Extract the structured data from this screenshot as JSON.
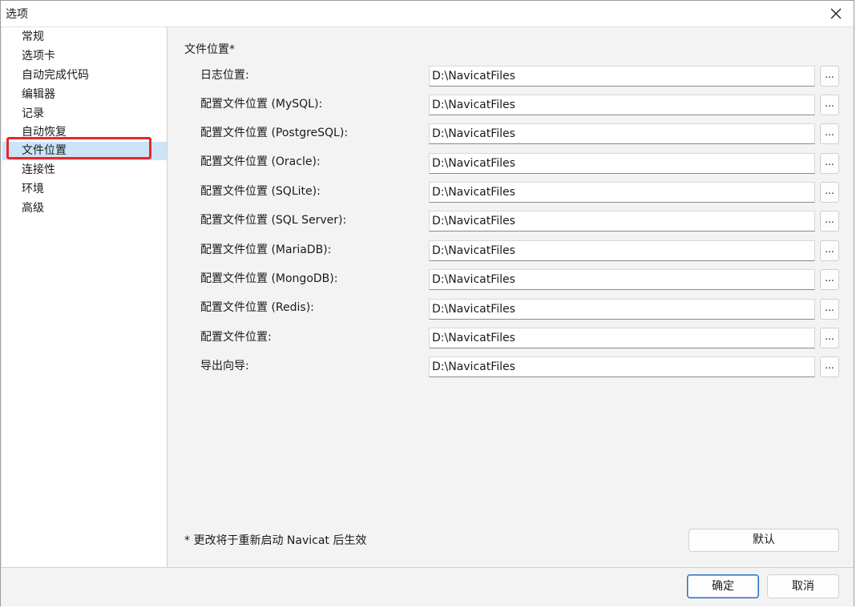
{
  "window": {
    "title": "选项",
    "close_icon": "close-icon"
  },
  "sidebar": {
    "selected_index": 6,
    "items": [
      {
        "label": "常规"
      },
      {
        "label": "选项卡"
      },
      {
        "label": "自动完成代码"
      },
      {
        "label": "编辑器"
      },
      {
        "label": "记录"
      },
      {
        "label": "自动恢复"
      },
      {
        "label": "文件位置"
      },
      {
        "label": "连接性"
      },
      {
        "label": "环境"
      },
      {
        "label": "高级"
      }
    ]
  },
  "main": {
    "section_title": "文件位置*",
    "rows": [
      {
        "label": "日志位置:",
        "value": "D:\\NavicatFiles",
        "button": "..."
      },
      {
        "label": "配置文件位置 (MySQL):",
        "value": "D:\\NavicatFiles",
        "button": "..."
      },
      {
        "label": "配置文件位置 (PostgreSQL):",
        "value": "D:\\NavicatFiles",
        "button": "..."
      },
      {
        "label": "配置文件位置 (Oracle):",
        "value": "D:\\NavicatFiles",
        "button": "..."
      },
      {
        "label": "配置文件位置 (SQLite):",
        "value": "D:\\NavicatFiles",
        "button": "..."
      },
      {
        "label": "配置文件位置 (SQL Server):",
        "value": "D:\\NavicatFiles",
        "button": "..."
      },
      {
        "label": "配置文件位置 (MariaDB):",
        "value": "D:\\NavicatFiles",
        "button": "..."
      },
      {
        "label": "配置文件位置 (MongoDB):",
        "value": "D:\\NavicatFiles",
        "button": "..."
      },
      {
        "label": "配置文件位置 (Redis):",
        "value": "D:\\NavicatFiles",
        "button": "..."
      },
      {
        "label": "配置文件位置:",
        "value": "D:\\NavicatFiles",
        "button": "..."
      },
      {
        "label": "导出向导:",
        "value": "D:\\NavicatFiles",
        "button": "..."
      }
    ],
    "note": "* 更改将于重新启动 Navicat 后生效",
    "default_button": "默认"
  },
  "footer": {
    "ok_label": "确定",
    "cancel_label": "取消"
  },
  "colors": {
    "accent": "#2a6ebd",
    "selection": "#cce4f7",
    "highlight": "#e8282b"
  }
}
